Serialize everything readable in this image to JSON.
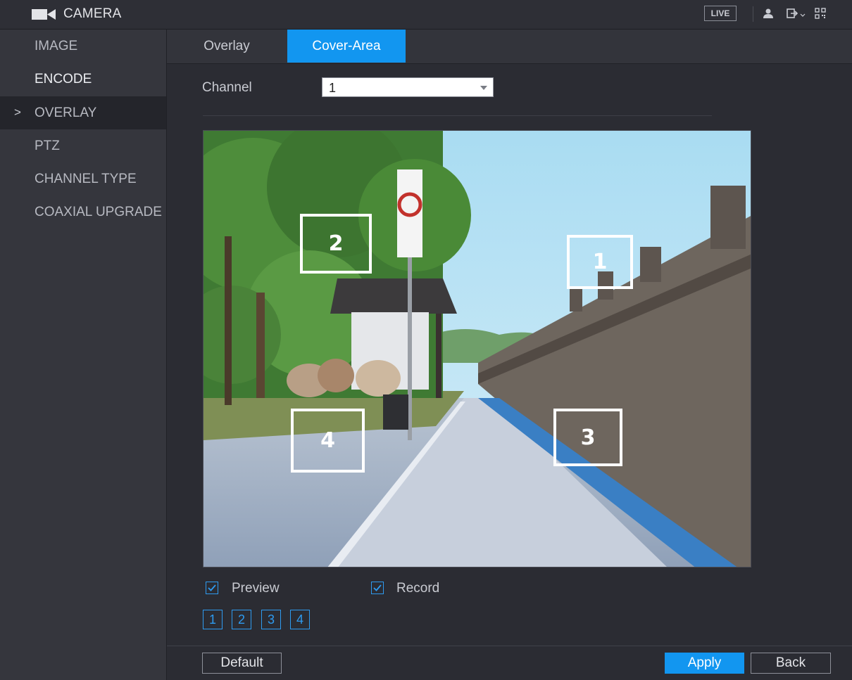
{
  "header": {
    "app_icon": "video-camera-icon",
    "title": "CAMERA",
    "live_label": "LIVE",
    "icons": [
      "user-icon",
      "logout-icon",
      "qr-code-icon"
    ]
  },
  "sidebar": {
    "items": [
      {
        "label": "IMAGE"
      },
      {
        "label": "ENCODE"
      },
      {
        "label": "OVERLAY"
      },
      {
        "label": "PTZ"
      },
      {
        "label": "CHANNEL TYPE"
      },
      {
        "label": "COAXIAL UPGRADE"
      }
    ],
    "active_index": 2,
    "active_marker": ">"
  },
  "tabs": [
    {
      "label": "Overlay"
    },
    {
      "label": "Cover-Area",
      "active": true
    }
  ],
  "form": {
    "channel_label": "Channel",
    "channel_value": "1"
  },
  "preview": {
    "cover_areas": [
      {
        "label": "1"
      },
      {
        "label": "2"
      },
      {
        "label": "3"
      },
      {
        "label": "4"
      }
    ]
  },
  "options": {
    "preview_label": "Preview",
    "preview_checked": true,
    "record_label": "Record",
    "record_checked": true
  },
  "area_buttons": [
    "1",
    "2",
    "3",
    "4"
  ],
  "footer": {
    "default_label": "Default",
    "apply_label": "Apply",
    "back_label": "Back"
  },
  "colors": {
    "accent": "#1296f0",
    "background": "#2b2c33",
    "sidebar": "#35363d"
  }
}
